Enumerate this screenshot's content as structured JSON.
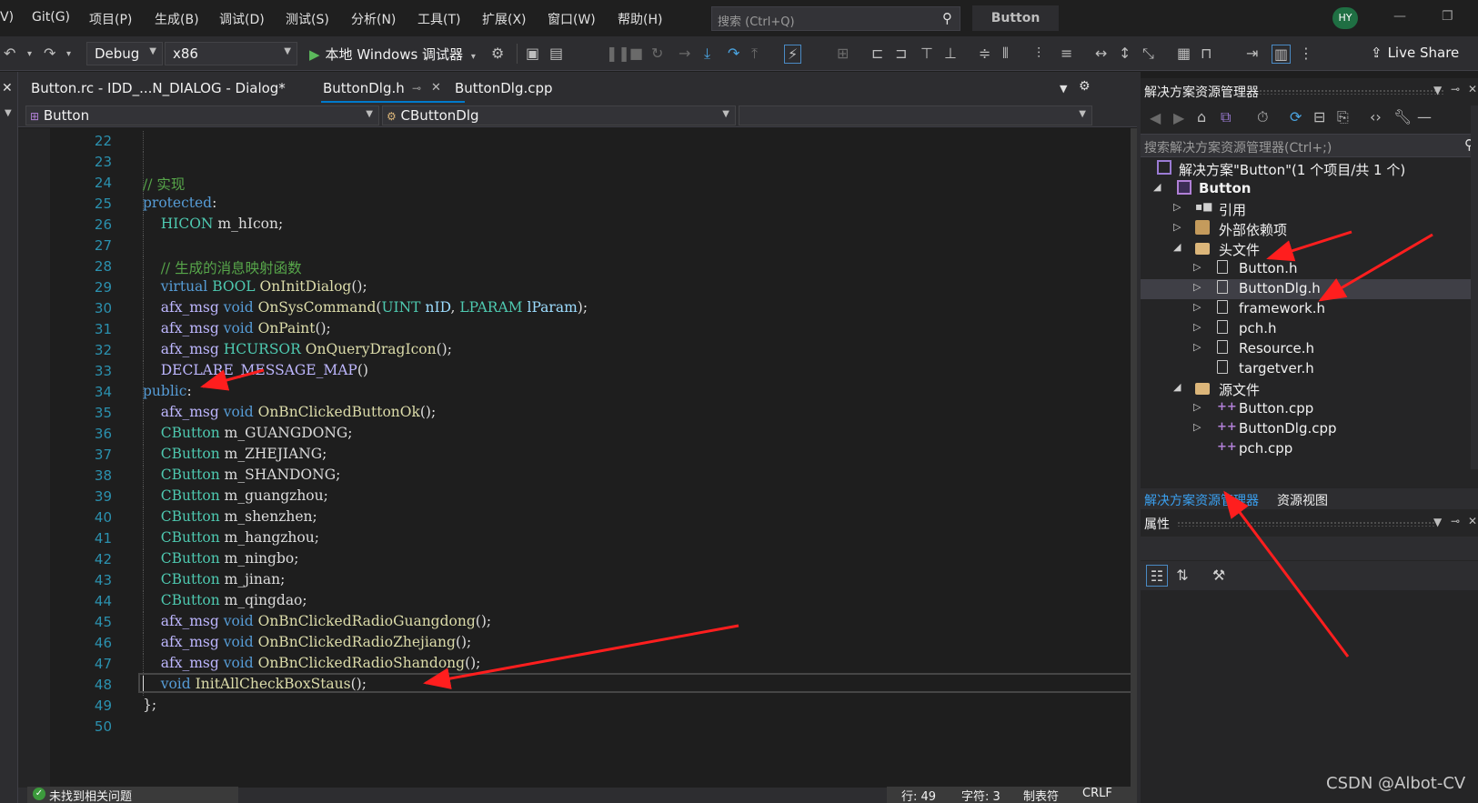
{
  "menu": [
    {
      "label": "V)"
    },
    {
      "label": "Git(G)"
    },
    {
      "label": "项目(P)"
    },
    {
      "label": "生成(B)"
    },
    {
      "label": "调试(D)"
    },
    {
      "label": "测试(S)"
    },
    {
      "label": "分析(N)"
    },
    {
      "label": "工具(T)"
    },
    {
      "label": "扩展(X)"
    },
    {
      "label": "窗口(W)"
    },
    {
      "label": "帮助(H)"
    }
  ],
  "search": {
    "placeholder": "搜索 (Ctrl+Q)"
  },
  "solution_title": "Button",
  "avatar_initials": "HY",
  "toolbar": {
    "configuration": "Debug",
    "platform": "x86",
    "run_label": "本地 Windows 调试器",
    "live_share": "Live Share"
  },
  "tabs": {
    "tab1": "Button.rc - IDD_...N_DIALOG - Dialog*",
    "tab2": "ButtonDlg.h",
    "tab3": "ButtonDlg.cpp"
  },
  "nav": {
    "project": "Button",
    "class": "CButtonDlg",
    "member": ""
  },
  "code_lines": [
    {
      "n": "22",
      "text": ""
    },
    {
      "n": "23",
      "text": ""
    },
    {
      "n": "24",
      "text": "// 实现"
    },
    {
      "n": "25",
      "text": "protected:"
    },
    {
      "n": "26",
      "text": "    HICON m_hIcon;"
    },
    {
      "n": "27",
      "text": ""
    },
    {
      "n": "28",
      "text": "    // 生成的消息映射函数"
    },
    {
      "n": "29",
      "text": "    virtual BOOL OnInitDialog();"
    },
    {
      "n": "30",
      "text": "    afx_msg void OnSysCommand(UINT nID, LPARAM lParam);"
    },
    {
      "n": "31",
      "text": "    afx_msg void OnPaint();"
    },
    {
      "n": "32",
      "text": "    afx_msg HCURSOR OnQueryDragIcon();"
    },
    {
      "n": "33",
      "text": "    DECLARE_MESSAGE_MAP()"
    },
    {
      "n": "34",
      "text": "public:"
    },
    {
      "n": "35",
      "text": "    afx_msg void OnBnClickedButtonOk();"
    },
    {
      "n": "36",
      "text": "    CButton m_GUANGDONG;"
    },
    {
      "n": "37",
      "text": "    CButton m_ZHEJIANG;"
    },
    {
      "n": "38",
      "text": "    CButton m_SHANDONG;"
    },
    {
      "n": "39",
      "text": "    CButton m_guangzhou;"
    },
    {
      "n": "40",
      "text": "    CButton m_shenzhen;"
    },
    {
      "n": "41",
      "text": "    CButton m_hangzhou;"
    },
    {
      "n": "42",
      "text": "    CButton m_ningbo;"
    },
    {
      "n": "43",
      "text": "    CButton m_jinan;"
    },
    {
      "n": "44",
      "text": "    CButton m_qingdao;"
    },
    {
      "n": "45",
      "text": "    afx_msg void OnBnClickedRadioGuangdong();"
    },
    {
      "n": "46",
      "text": "    afx_msg void OnBnClickedRadioZhejiang();"
    },
    {
      "n": "47",
      "text": "    afx_msg void OnBnClickedRadioShandong();"
    },
    {
      "n": "48",
      "text": "    void InitAllCheckBoxStaus();"
    },
    {
      "n": "49",
      "text": "};"
    },
    {
      "n": "50",
      "text": ""
    }
  ],
  "status": {
    "issues": "未找到相关问题",
    "line": "行: 49",
    "col": "字符: 3",
    "tabs": "制表符",
    "eol": "CRLF"
  },
  "solution_explorer": {
    "title": "解决方案资源管理器",
    "search_placeholder": "搜索解决方案资源管理器(Ctrl+;)",
    "tree": [
      {
        "label": "解决方案\"Button\"(1 个项目/共 1 个)"
      },
      {
        "label": "Button"
      },
      {
        "label": "引用"
      },
      {
        "label": "外部依赖项"
      },
      {
        "label": "头文件"
      },
      {
        "label": "Button.h"
      },
      {
        "label": "ButtonDlg.h"
      },
      {
        "label": "framework.h"
      },
      {
        "label": "pch.h"
      },
      {
        "label": "Resource.h"
      },
      {
        "label": "targetver.h"
      },
      {
        "label": "源文件"
      },
      {
        "label": "Button.cpp"
      },
      {
        "label": "ButtonDlg.cpp"
      },
      {
        "label": "pch.cpp"
      }
    ],
    "tab_active": "解决方案资源管理器",
    "tab_other": "资源视图"
  },
  "properties": {
    "title": "属性"
  },
  "watermark": "CSDN @Albot-CV",
  "colors": {
    "accent": "#007acc",
    "annotation_arrow": "#ff1e1e"
  }
}
